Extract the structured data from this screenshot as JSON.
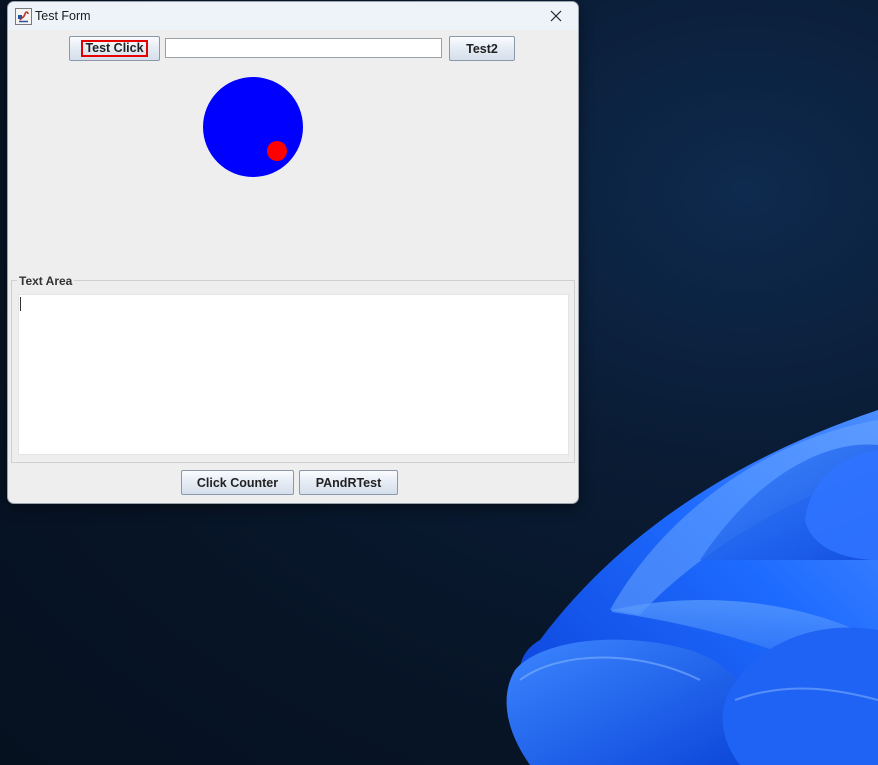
{
  "window": {
    "title": "Test Form",
    "app_icon": "java-app-icon",
    "close_icon": "close-icon"
  },
  "toolbar": {
    "test_click_label": "Test Click",
    "text_input_value": "",
    "test2_label": "Test2"
  },
  "canvas": {
    "big_circle_color": "#0000ff",
    "small_circle_color": "#ff0000"
  },
  "text_area": {
    "title": "Text Area",
    "value": ""
  },
  "footer": {
    "click_counter_label": "Click Counter",
    "pandr_label": "PAndRTest"
  }
}
